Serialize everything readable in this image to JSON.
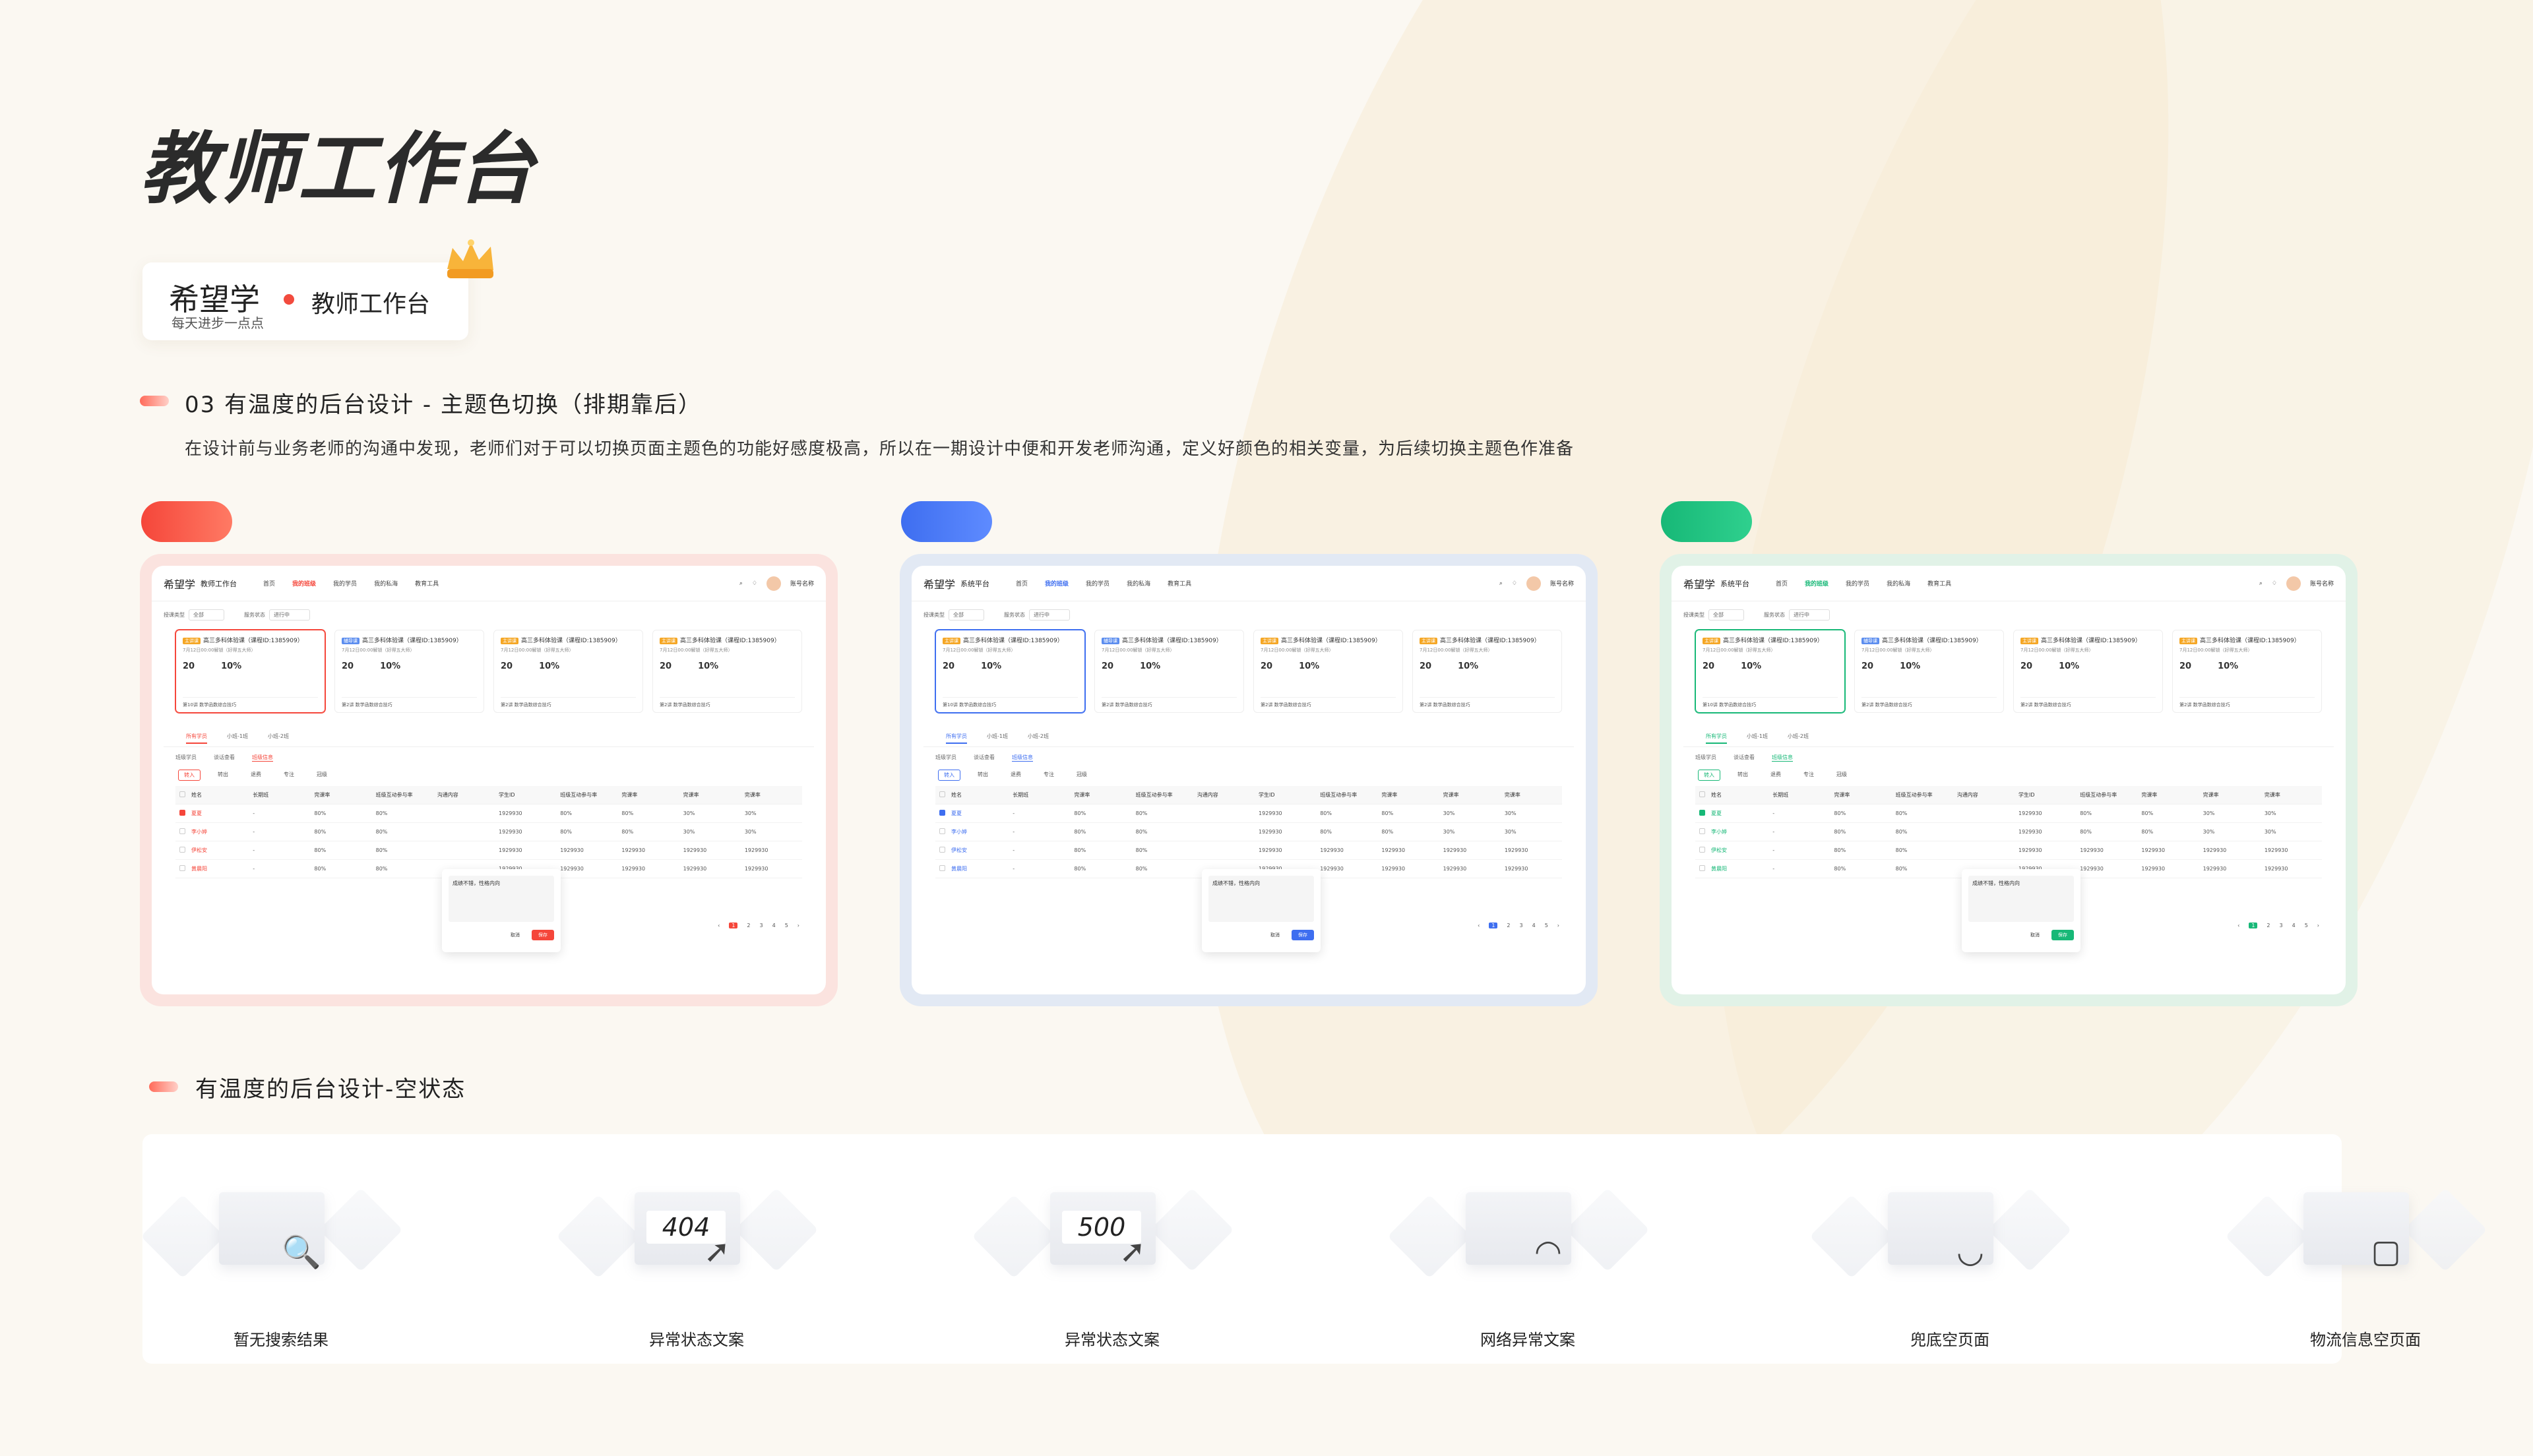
{
  "page_title": "教师工作台",
  "brand": {
    "logo_text": "希望学",
    "tagline": "每天进步一点点",
    "title": "教师工作台"
  },
  "section1": {
    "title": "03 有温度的后台设计 - 主题色切换（排期靠后）",
    "description": "在设计前与业务老师的沟通中发现，老师们对于可以切换页面主题色的功能好感度极高，所以在一期设计中便和开发老师沟通，定义好颜色的相关变量，为后续切换主题色作准备"
  },
  "themes": [
    {
      "color": "#f5463a",
      "frame_color": "#fbe3df",
      "app_subtitle": "教师工作台",
      "nav": [
        "首页",
        "我的班级",
        "我的学员",
        "我的私海",
        "教育工具"
      ],
      "user": "账号名称",
      "filters": [
        "授课类型",
        "全部",
        "服务状态",
        "进行中"
      ],
      "cards": [
        {
          "tag": "主讲课",
          "name": "高三多科体验课（课程ID:1385909）",
          "sub": "7月12日00:00解锁（好得五大师）",
          "n1": "20",
          "n2": "10%",
          "foot": "第10讲 数学函数综合技巧"
        },
        {
          "tag": "辅导课",
          "name": "高三多科体验课（课程ID:1385909）",
          "sub": "7月12日00:00解锁（好得五大师）",
          "n1": "20",
          "n2": "10%",
          "foot": "第2讲 数学函数综合技巧"
        },
        {
          "tag": "主讲课",
          "name": "高三多科体验课（课程ID:1385909）",
          "sub": "7月12日00:00解锁（好得五大师）",
          "n1": "20",
          "n2": "10%",
          "foot": "第2讲 数学函数综合技巧"
        },
        {
          "tag": "主讲课",
          "name": "高三多科体验课（课程ID:1385909）",
          "sub": "7月12日00:00解锁（好得五大师）",
          "n1": "20",
          "n2": "10%",
          "foot": "第2讲 数学函数综合技巧"
        }
      ],
      "tabs": [
        "所有学员",
        "小班-1班",
        "小班-2班"
      ],
      "subtabs": [
        "班级学员",
        "谈话查看",
        "班级信息"
      ],
      "tags": [
        "转入",
        "转出",
        "退费",
        "专注",
        "冠级"
      ],
      "columns": [
        "姓名",
        "长期班",
        "完课率",
        "班级互动参与率",
        "沟通内容",
        "学生ID",
        "班级互动参与率",
        "完课率",
        "完课率",
        "完课率"
      ],
      "rows": [
        [
          "夏夏",
          "-",
          "80%",
          "80%",
          "",
          "1929930",
          "80%",
          "80%",
          "30%",
          "30%"
        ],
        [
          "李小婷",
          "-",
          "80%",
          "80%",
          "",
          "1929930",
          "80%",
          "80%",
          "30%",
          "30%"
        ],
        [
          "伊松安",
          "-",
          "80%",
          "80%",
          "",
          "1929930",
          "1929930",
          "1929930",
          "1929930",
          "1929930"
        ],
        [
          "黄晨阳",
          "-",
          "80%",
          "80%",
          "",
          "1929930",
          "1929930",
          "1929930",
          "1929930",
          "1929930"
        ]
      ],
      "popup_text": "成绩不错，性格内向",
      "popup_cancel": "取消",
      "popup_ok": "保存",
      "pager": [
        "1",
        "2",
        "3",
        "4",
        "5"
      ]
    },
    {
      "color": "#3e6ef0",
      "frame_color": "#e2e9f4",
      "app_subtitle": "系统平台",
      "nav": [
        "首页",
        "我的班级",
        "我的学员",
        "我的私海",
        "教育工具"
      ],
      "user": "账号名称",
      "filters": [
        "授课类型",
        "全部",
        "服务状态",
        "进行中"
      ],
      "cards": [
        {
          "tag": "主讲课",
          "name": "高三多科体验课（课程ID:1385909）",
          "sub": "7月12日00:00解锁（好得五大师）",
          "n1": "20",
          "n2": "10%",
          "foot": "第10讲 数学函数综合技巧"
        },
        {
          "tag": "辅导课",
          "name": "高三多科体验课（课程ID:1385909）",
          "sub": "7月12日00:00解锁（好得五大师）",
          "n1": "20",
          "n2": "10%",
          "foot": "第2讲 数学函数综合技巧"
        },
        {
          "tag": "主讲课",
          "name": "高三多科体验课（课程ID:1385909）",
          "sub": "7月12日00:00解锁（好得五大师）",
          "n1": "20",
          "n2": "10%",
          "foot": "第2讲 数学函数综合技巧"
        },
        {
          "tag": "主讲课",
          "name": "高三多科体验课（课程ID:1385909）",
          "sub": "7月12日00:00解锁（好得五大师）",
          "n1": "20",
          "n2": "10%",
          "foot": "第2讲 数学函数综合技巧"
        }
      ],
      "tabs": [
        "所有学员",
        "小班-1班",
        "小班-2班"
      ],
      "subtabs": [
        "班级学员",
        "谈话查看",
        "班级信息"
      ],
      "tags": [
        "转入",
        "转出",
        "退费",
        "专注",
        "冠级"
      ],
      "columns": [
        "姓名",
        "长期班",
        "完课率",
        "班级互动参与率",
        "沟通内容",
        "学生ID",
        "班级互动参与率",
        "完课率",
        "完课率",
        "完课率"
      ],
      "rows": [
        [
          "夏夏",
          "-",
          "80%",
          "80%",
          "",
          "1929930",
          "80%",
          "80%",
          "30%",
          "30%"
        ],
        [
          "李小婷",
          "-",
          "80%",
          "80%",
          "",
          "1929930",
          "80%",
          "80%",
          "30%",
          "30%"
        ],
        [
          "伊松安",
          "-",
          "80%",
          "80%",
          "",
          "1929930",
          "1929930",
          "1929930",
          "1929930",
          "1929930"
        ],
        [
          "黄晨阳",
          "-",
          "80%",
          "80%",
          "",
          "1929930",
          "1929930",
          "1929930",
          "1929930",
          "1929930"
        ]
      ],
      "popup_text": "成绩不错，性格内向",
      "popup_cancel": "取消",
      "popup_ok": "保存",
      "pager": [
        "1",
        "2",
        "3",
        "4",
        "5"
      ]
    },
    {
      "color": "#17b877",
      "frame_color": "#e1f2e7",
      "app_subtitle": "系统平台",
      "nav": [
        "首页",
        "我的班级",
        "我的学员",
        "我的私海",
        "教育工具"
      ],
      "user": "账号名称",
      "filters": [
        "授课类型",
        "全部",
        "服务状态",
        "进行中"
      ],
      "cards": [
        {
          "tag": "主讲课",
          "name": "高三多科体验课（课程ID:1385909）",
          "sub": "7月12日00:00解锁（好得五大师）",
          "n1": "20",
          "n2": "10%",
          "foot": "第10讲 数学函数综合技巧"
        },
        {
          "tag": "辅导课",
          "name": "高三多科体验课（课程ID:1385909）",
          "sub": "7月12日00:00解锁（好得五大师）",
          "n1": "20",
          "n2": "10%",
          "foot": "第2讲 数学函数综合技巧"
        },
        {
          "tag": "主讲课",
          "name": "高三多科体验课（课程ID:1385909）",
          "sub": "7月12日00:00解锁（好得五大师）",
          "n1": "20",
          "n2": "10%",
          "foot": "第2讲 数学函数综合技巧"
        },
        {
          "tag": "主讲课",
          "name": "高三多科体验课（课程ID:1385909）",
          "sub": "7月12日00:00解锁（好得五大师）",
          "n1": "20",
          "n2": "10%",
          "foot": "第2讲 数学函数综合技巧"
        }
      ],
      "tabs": [
        "所有学员",
        "小班-1班",
        "小班-2班"
      ],
      "subtabs": [
        "班级学员",
        "谈话查看",
        "班级信息"
      ],
      "tags": [
        "转入",
        "转出",
        "退费",
        "专注",
        "冠级"
      ],
      "columns": [
        "姓名",
        "长期班",
        "完课率",
        "班级互动参与率",
        "沟通内容",
        "学生ID",
        "班级互动参与率",
        "完课率",
        "完课率",
        "完课率"
      ],
      "rows": [
        [
          "夏夏",
          "-",
          "80%",
          "80%",
          "",
          "1929930",
          "80%",
          "80%",
          "30%",
          "30%"
        ],
        [
          "李小婷",
          "-",
          "80%",
          "80%",
          "",
          "1929930",
          "80%",
          "80%",
          "30%",
          "30%"
        ],
        [
          "伊松安",
          "-",
          "80%",
          "80%",
          "",
          "1929930",
          "1929930",
          "1929930",
          "1929930",
          "1929930"
        ],
        [
          "黄晨阳",
          "-",
          "80%",
          "80%",
          "",
          "1929930",
          "1929930",
          "1929930",
          "1929930",
          "1929930"
        ]
      ],
      "popup_text": "成绩不错，性格内向",
      "popup_cancel": "取消",
      "popup_ok": "保存",
      "pager": [
        "1",
        "2",
        "3",
        "4",
        "5"
      ]
    }
  ],
  "section2": {
    "title": "有温度的后台设计-空状态"
  },
  "empty_states": [
    {
      "label": "暂无搜索结果",
      "icon": "magnifier-icon",
      "code": ""
    },
    {
      "label": "异常状态文案",
      "icon": "cursor-icon",
      "code": "404"
    },
    {
      "label": "异常状态文案",
      "icon": "cursor-icon",
      "code": "500"
    },
    {
      "label": "网络异常文案",
      "icon": "wifi-icon",
      "code": ""
    },
    {
      "label": "兜底空页面",
      "icon": "empty-box-icon",
      "code": ""
    },
    {
      "label": "物流信息空页面",
      "icon": "package-icon",
      "code": ""
    }
  ],
  "colors": {
    "accent_red": "#f5463a",
    "accent_blue": "#3e6ef0",
    "accent_green": "#17b877",
    "background": "#fbf8f2"
  }
}
